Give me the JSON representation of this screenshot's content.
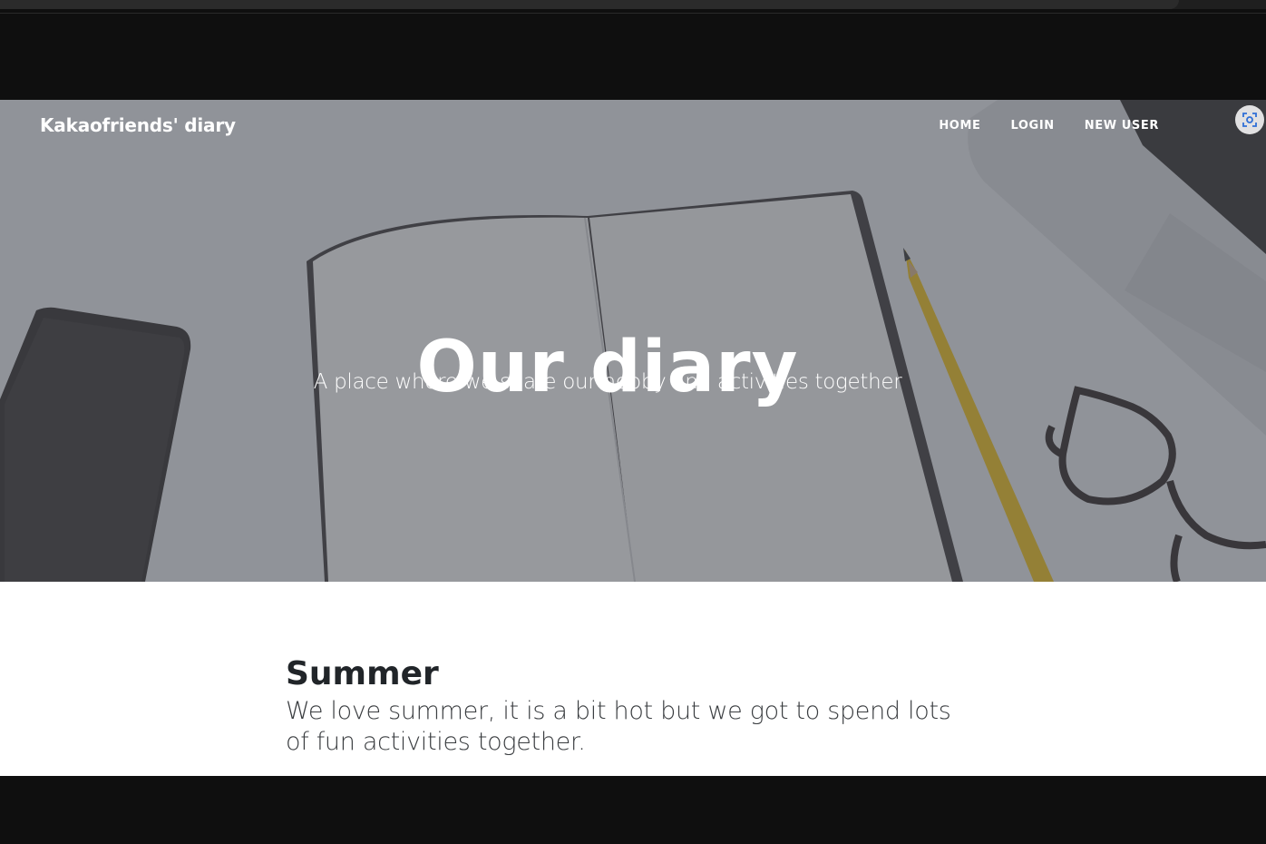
{
  "site": {
    "brand": "Kakaofriends' diary"
  },
  "nav": {
    "items": [
      {
        "label": "HOME"
      },
      {
        "label": "LOGIN"
      },
      {
        "label": "NEW USER"
      }
    ]
  },
  "hero": {
    "title": "Our diary",
    "subtitle": "A place where we share our hobby and activities together"
  },
  "post": {
    "title": "Summer",
    "subtitle": "We love summer, it is a bit hot but we got to spend lots of fun activities together."
  },
  "icons": {
    "screen_capture": "screen-capture-icon"
  }
}
